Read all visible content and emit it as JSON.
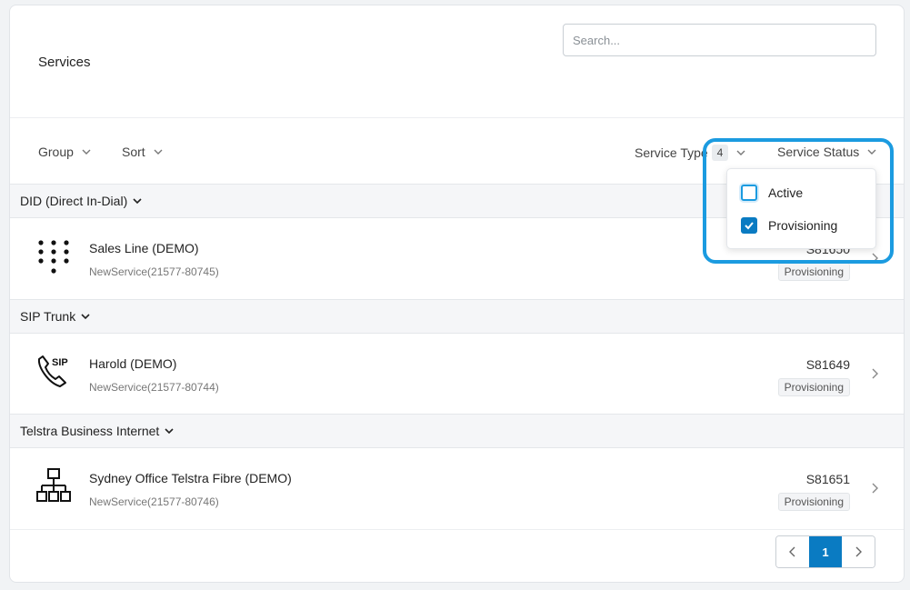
{
  "header": {
    "title": "Services",
    "search_placeholder": "Search..."
  },
  "toolbar": {
    "group_label": "Group",
    "sort_label": "Sort",
    "service_type_label": "Service Type",
    "service_type_count": "4",
    "service_status_label": "Service Status"
  },
  "status_dropdown": {
    "options": [
      {
        "label": "Active",
        "checked": false
      },
      {
        "label": "Provisioning",
        "checked": true
      }
    ]
  },
  "groups": [
    {
      "name": "DID (Direct In-Dial)",
      "icon": "dialpad-icon",
      "service": {
        "title": "Sales Line (DEMO)",
        "subtitle": "NewService(21577-80745)",
        "id": "S81650",
        "status": "Provisioning"
      }
    },
    {
      "name": "SIP Trunk",
      "icon": "sip-phone-icon",
      "service": {
        "title": "Harold (DEMO)",
        "subtitle": "NewService(21577-80744)",
        "id": "S81649",
        "status": "Provisioning"
      }
    },
    {
      "name": "Telstra Business Internet",
      "icon": "network-icon",
      "service": {
        "title": "Sydney Office Telstra Fibre (DEMO)",
        "subtitle": "NewService(21577-80746)",
        "id": "S81651",
        "status": "Provisioning"
      }
    }
  ],
  "pagination": {
    "current_page": "1",
    "prev_icon": "chevron-left-icon",
    "next_icon": "chevron-right-icon"
  },
  "colors": {
    "accent": "#0a7bc2",
    "highlight": "#1b9be0"
  }
}
